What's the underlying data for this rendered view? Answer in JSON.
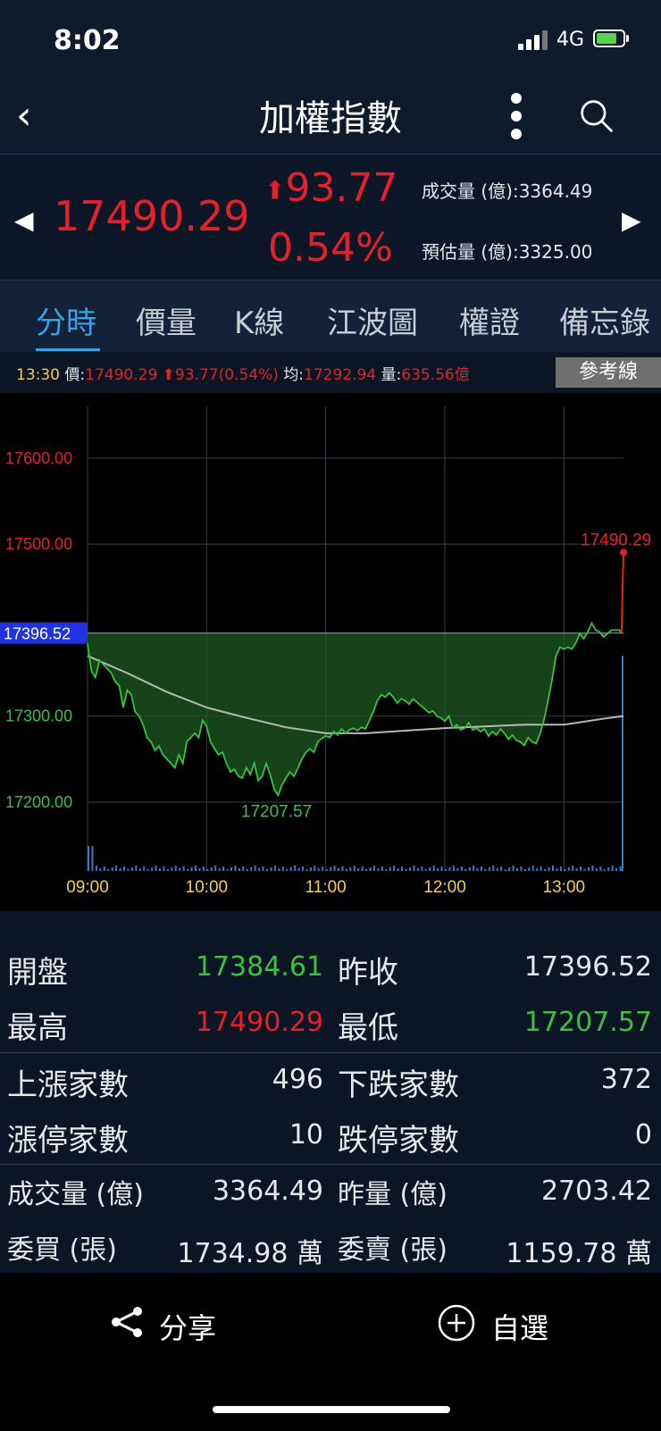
{
  "status_bar": {
    "time": "8:02",
    "network": "4G"
  },
  "header": {
    "title": "加權指數"
  },
  "quote": {
    "price": "17490.29",
    "change": "93.77",
    "change_pct": "0.54%",
    "volume_text": "成交量 (億):3364.49",
    "est_volume_text": "預估量 (億):3325.00"
  },
  "tabs": [
    "分時",
    "價量",
    "K線",
    "江波圖",
    "權證",
    "備忘錄"
  ],
  "chart_info": {
    "time": "13:30",
    "price_label": "價:",
    "price_value": "17490.29",
    "change_value": "93.77(0.54%)",
    "avg_label": "均:",
    "avg_value": "17292.94",
    "vol_label": "量:",
    "vol_value": "635.56億",
    "ref_button": "參考線"
  },
  "chart_data": {
    "type": "line",
    "x_ticks": [
      "09:00",
      "10:00",
      "11:00",
      "12:00",
      "13:00"
    ],
    "y_ticks": [
      "17600.00",
      "17500.00",
      "17300.00",
      "17200.00"
    ],
    "y_tick_values": [
      17600,
      17500,
      17300,
      17200
    ],
    "ylim": [
      17120,
      17660
    ],
    "xlim_minutes": [
      0,
      270
    ],
    "reference_label": "17396.52",
    "reference": 17396.52,
    "low_label": "17207.57",
    "low": 17207.57,
    "low_time_minutes": 97,
    "last_label": "17490.29",
    "last": 17490.29,
    "colors": {
      "up": "#e4212b",
      "down": "#37c340",
      "avg": "#b9b9b9",
      "volume": "#3c78c8",
      "reference": "#2033e0"
    },
    "series": [
      {
        "x": [
          0,
          2,
          4,
          6,
          8,
          10,
          12,
          14,
          16,
          18,
          20,
          22,
          24,
          26,
          28,
          30,
          32,
          34,
          36,
          38,
          40,
          42,
          44,
          46,
          48,
          50,
          52,
          54,
          56,
          58,
          60,
          62,
          64,
          66,
          68,
          70,
          72,
          74,
          76,
          78,
          80,
          82,
          84,
          86,
          88,
          90,
          92,
          94,
          96,
          98,
          100,
          102,
          104,
          106,
          108,
          110,
          112,
          114,
          116,
          118,
          120,
          122,
          124,
          126,
          128,
          130,
          132,
          134,
          136,
          138,
          140,
          142,
          144,
          146,
          148,
          150,
          152,
          154,
          156,
          158,
          160,
          162,
          164,
          166,
          168,
          170,
          172,
          174,
          176,
          178,
          180,
          182,
          184,
          186,
          188,
          190,
          192,
          194,
          196,
          198,
          200,
          202,
          204,
          206,
          208,
          210,
          212,
          214,
          216,
          218,
          220,
          222,
          224,
          226,
          228,
          230,
          232,
          234,
          236,
          238,
          240,
          242,
          244,
          246,
          248,
          250,
          252,
          254,
          256,
          258,
          260,
          262,
          264,
          266,
          268,
          269,
          270
        ],
        "values": [
          17384.61,
          17352,
          17345,
          17365,
          17360,
          17355,
          17350,
          17340,
          17335,
          17310,
          17330,
          17325,
          17305,
          17300,
          17290,
          17275,
          17270,
          17260,
          17265,
          17255,
          17250,
          17245,
          17240,
          17255,
          17245,
          17270,
          17275,
          17280,
          17275,
          17295,
          17288,
          17270,
          17262,
          17255,
          17258,
          17245,
          17235,
          17238,
          17230,
          17228,
          17240,
          17232,
          17245,
          17225,
          17230,
          17245,
          17232,
          17215,
          17208,
          17220,
          17228,
          17235,
          17230,
          17240,
          17250,
          17258,
          17262,
          17258,
          17270,
          17274,
          17277,
          17275,
          17282,
          17278,
          17285,
          17280,
          17284,
          17286,
          17283,
          17287,
          17285,
          17295,
          17305,
          17318,
          17325,
          17322,
          17327,
          17322,
          17315,
          17320,
          17318,
          17314,
          17320,
          17316,
          17312,
          17308,
          17304,
          17306,
          17300,
          17298,
          17294,
          17300,
          17286,
          17290,
          17284,
          17286,
          17292,
          17284,
          17286,
          17282,
          17285,
          17277,
          17282,
          17278,
          17285,
          17280,
          17273,
          17278,
          17272,
          17270,
          17266,
          17275,
          17270,
          17268,
          17280,
          17296,
          17318,
          17342,
          17370,
          17380,
          17378,
          17380,
          17378,
          17385,
          17396,
          17390,
          17398,
          17408,
          17400,
          17398,
          17392,
          17396,
          17400,
          17400,
          17400,
          17396.52,
          17490.29
        ]
      },
      {
        "name": "均價",
        "x": [
          0,
          20,
          40,
          60,
          80,
          100,
          120,
          140,
          160,
          180,
          200,
          220,
          240,
          260,
          270
        ],
        "values": [
          17370,
          17350,
          17328,
          17310,
          17298,
          17287,
          17280,
          17280,
          17283,
          17286,
          17288,
          17290,
          17290,
          17297,
          17300
        ]
      }
    ]
  },
  "stats": {
    "open_label": "開盤",
    "open_value": "17384.61",
    "prev_close_label": "昨收",
    "prev_close_value": "17396.52",
    "high_label": "最高",
    "high_value": "17490.29",
    "low_label": "最低",
    "low_value": "17207.57",
    "up_count_label": "上漲家數",
    "up_count_value": "496",
    "down_count_label": "下跌家數",
    "down_count_value": "372",
    "limit_up_label": "漲停家數",
    "limit_up_value": "10",
    "limit_down_label": "跌停家數",
    "limit_down_value": "0",
    "volume_label": "成交量 (億)",
    "volume_value": "3364.49",
    "prev_volume_label": "昨量 (億)",
    "prev_volume_value": "2703.42",
    "bid_label": "委買 (張)",
    "bid_value": "1734.98 萬",
    "ask_label": "委賣 (張)",
    "ask_value": "1159.78 萬"
  },
  "bottom_bar": {
    "share": "分享",
    "watchlist": "自選"
  }
}
